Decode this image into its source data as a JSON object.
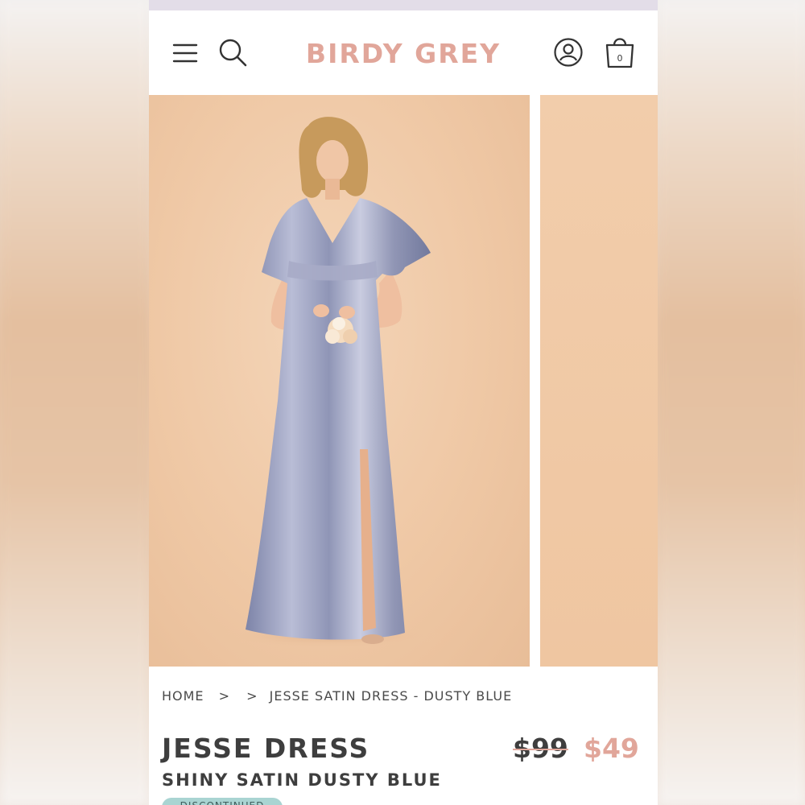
{
  "brand": {
    "name": "BIRDY GREY",
    "color": "#e1a69a"
  },
  "header": {
    "icons": [
      "menu-icon",
      "search-icon",
      "account-icon",
      "shopping-bag-icon"
    ],
    "cart_count": "0"
  },
  "breadcrumb": {
    "home": "HOME",
    "separator1": ">",
    "separator2": ">",
    "current": "JESSE SATIN DRESS - DUSTY BLUE"
  },
  "product": {
    "title": "JESSE DRESS",
    "subtitle": "SHINY SATIN DUSTY BLUE",
    "price_original": "$99",
    "price_sale": "$49",
    "badge": "DISCONTINUED"
  },
  "colors": {
    "accent": "#e1a69a",
    "photo_background": "#efc8a5",
    "dress": "#9fa4c0",
    "badge": "#a9d4d2"
  }
}
